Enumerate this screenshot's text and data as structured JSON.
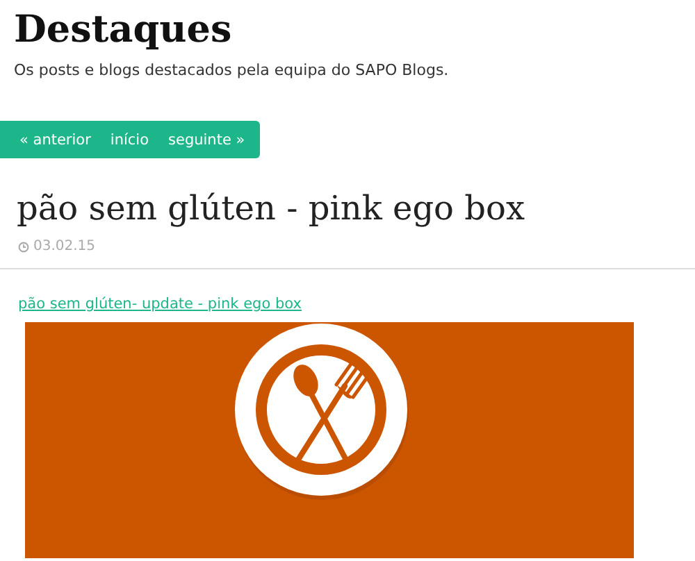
{
  "blog": {
    "title": "Destaques",
    "description": "Os posts e blogs destacados pela equipa do SAPO Blogs."
  },
  "nav": [
    {
      "label": "« anterior"
    },
    {
      "label": "início"
    },
    {
      "label": "seguinte »"
    }
  ],
  "post": {
    "title": "pão sem glúten - pink ego box",
    "date": "03.02.15",
    "link": "pão sem glúten- update - pink ego box"
  }
}
